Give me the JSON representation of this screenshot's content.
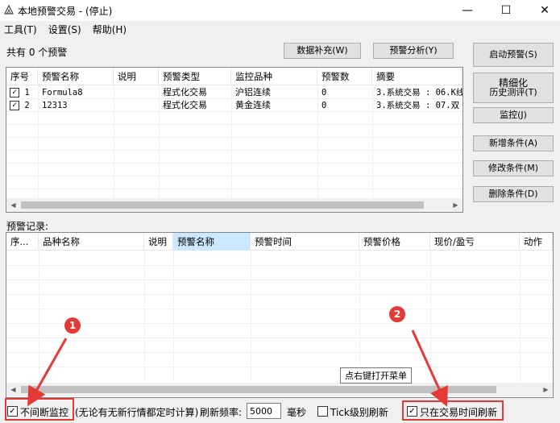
{
  "window": {
    "title": "本地预警交易  - (停止)",
    "min_glyph": "—",
    "max_glyph": "☐",
    "close_glyph": "✕"
  },
  "menu": [
    "工具(T)",
    "设置(S)",
    "帮助(H)"
  ],
  "summary": "共有 0 个预警",
  "buttons": {
    "data_supplement": "数据补充(W)",
    "alert_analysis": "预警分析(Y)",
    "start_alert": "启动预警(S)",
    "refine_line1": "精细化",
    "refine_line2": "历史测评(T)",
    "monitor": "监控(J)",
    "add_condition": "新增条件(A)",
    "edit_condition": "修改条件(M)",
    "delete_condition": "删除条件(D)"
  },
  "alerts_table": {
    "columns": [
      "序号",
      "预警名称",
      "说明",
      "预警类型",
      "监控品种",
      "预警数",
      "摘要"
    ],
    "rows": [
      {
        "checked": true,
        "no": "1",
        "name": "Formula8",
        "desc": "",
        "type": "程式化交易",
        "product": "沪铝连续",
        "count": "0",
        "summary": "3.系统交易 : 06.K线"
      },
      {
        "checked": true,
        "no": "2",
        "name": "12313",
        "desc": "",
        "type": "程式化交易",
        "product": "黄金连续",
        "count": "0",
        "summary": "3.系统交易 : 07.双"
      }
    ]
  },
  "records_label": "预警记录:",
  "records_table": {
    "columns": [
      "序...",
      "品种名称",
      "说明",
      "预警名称",
      "预警时间",
      "预警价格",
      "现价/盈亏",
      "动作"
    ]
  },
  "tooltip": "点右键打开菜单",
  "bottom": {
    "nonstop_checked": true,
    "nonstop_label": "不间断监控",
    "nonstop_note": "(无论有无新行情都定时计算)",
    "rate_label": "刷新频率:",
    "rate_value": "5000",
    "rate_unit": "毫秒",
    "tick_checked": false,
    "tick_label": "Tick级别刷新",
    "trade_time_checked": true,
    "trade_time_label": "只在交易时间刷新"
  },
  "annotations": {
    "one": "1",
    "two": "2"
  },
  "colors": {
    "annotation": "#e53935",
    "header_highlight": "#cce8ff"
  }
}
